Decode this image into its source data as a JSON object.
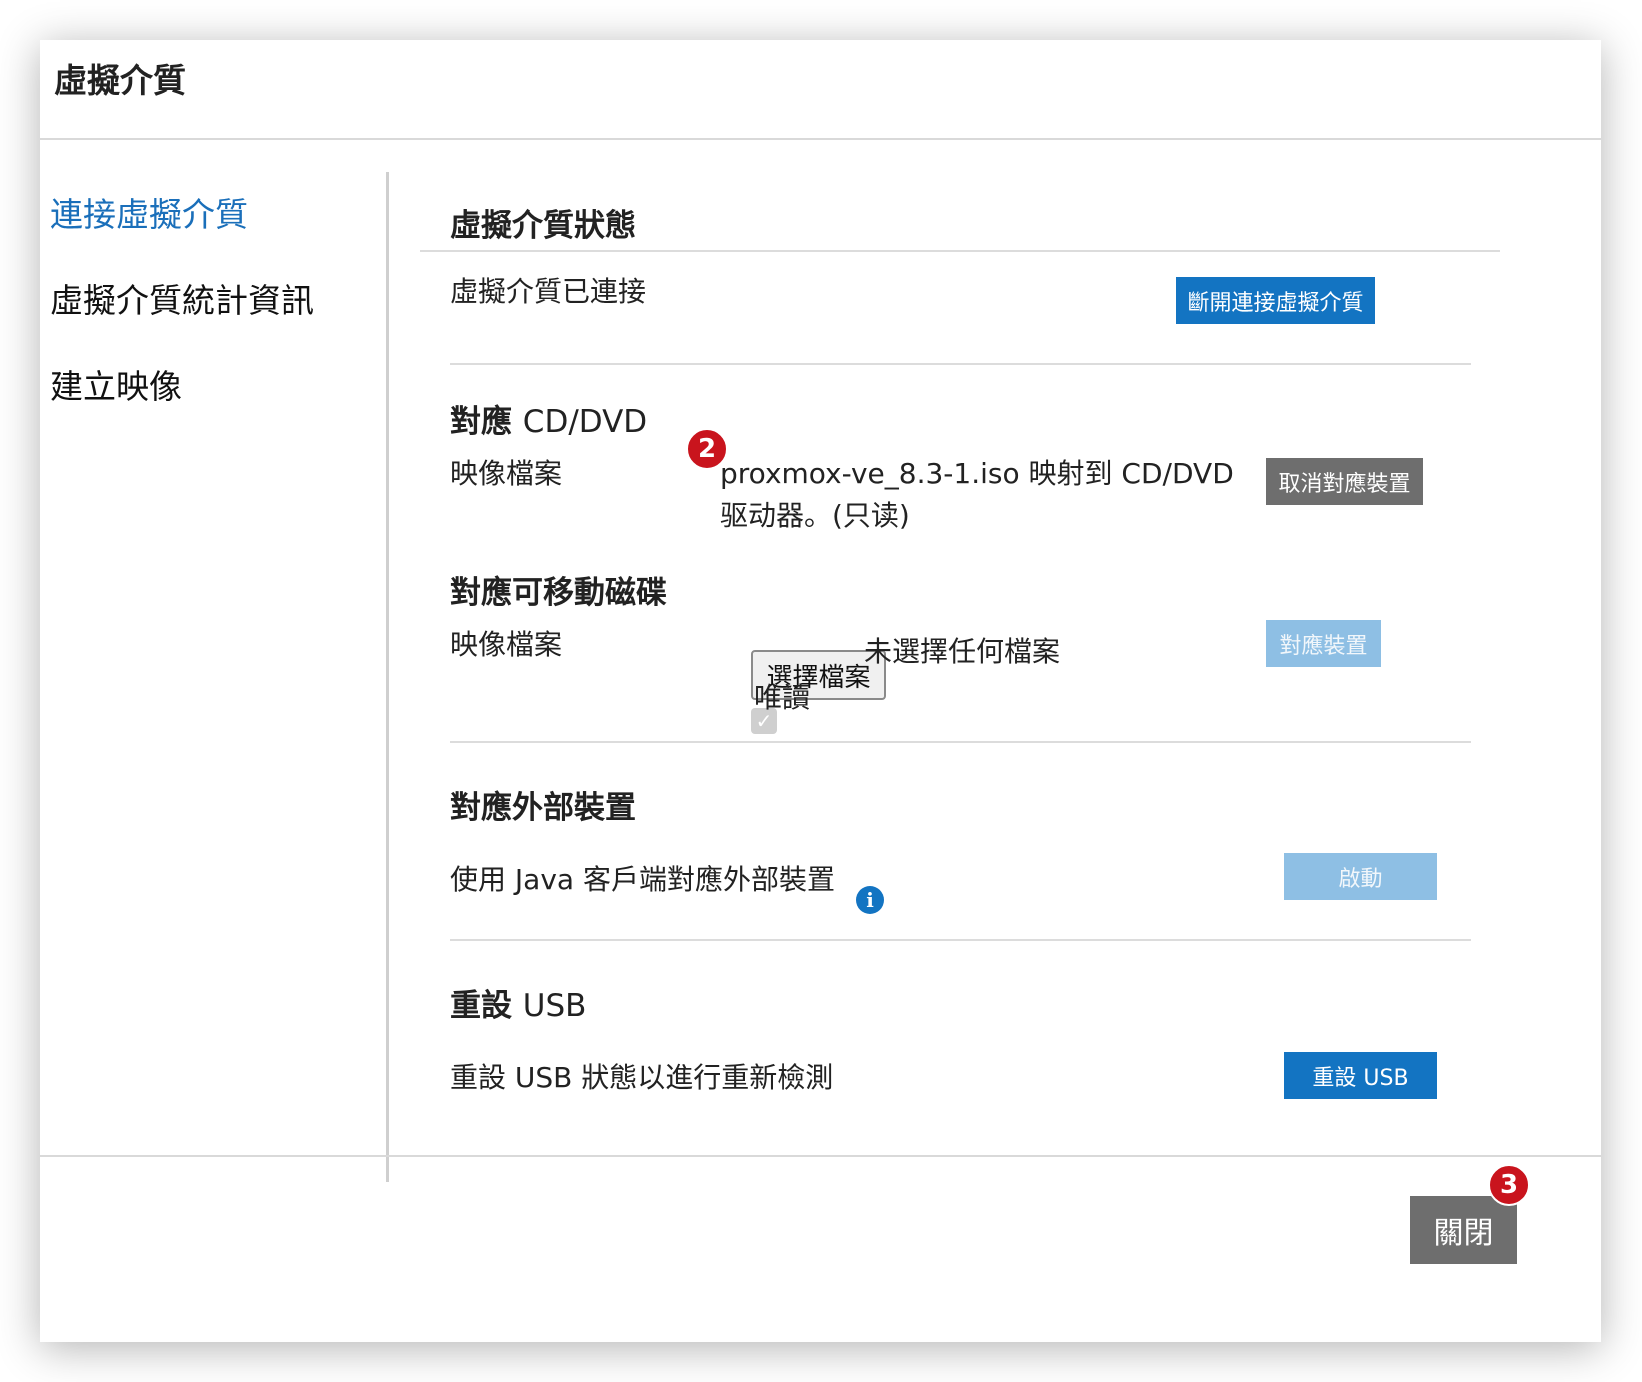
{
  "dialog": {
    "title": "虛擬介質"
  },
  "sidebar": {
    "items": [
      {
        "label": "連接虛擬介質",
        "active": true
      },
      {
        "label": "虛擬介質統計資訊",
        "active": false
      },
      {
        "label": "建立映像",
        "active": false
      }
    ]
  },
  "status": {
    "title": "虛擬介質狀態",
    "text": "虛擬介質已連接",
    "disconnect_label": "斷開連接虛擬介質"
  },
  "cd_dvd": {
    "title_bold": "對應",
    "title_rest": "CD/DVD",
    "label": "映像檔案",
    "mapped_line1": "proxmox-ve_8.3-1.iso 映射到 CD/DVD",
    "mapped_line2": "驱动器。(只读)",
    "unmap_label": "取消對應裝置"
  },
  "removable": {
    "title": "對應可移動磁碟",
    "label": "映像檔案",
    "choose_file_label": "選擇檔案",
    "no_file_text": "未選擇任何檔案",
    "readonly_label": "唯讀",
    "readonly_checked": true,
    "map_label": "對應裝置"
  },
  "external": {
    "title": "對應外部裝置",
    "text": "使用 Java 客戶端對應外部裝置",
    "start_label": "啟動"
  },
  "usb": {
    "title_bold": "重設",
    "title_rest": "USB",
    "text": "重設 USB 狀態以進行重新檢測",
    "reset_label": "重設 USB"
  },
  "footer": {
    "close_label": "關閉"
  },
  "badges": {
    "badge2": "2",
    "badge3": "3"
  },
  "colors": {
    "accent": "#1374c2",
    "active_link": "#1a6fba",
    "gray_button": "#6e6e6e",
    "disabled_button": "#8ebfe4",
    "badge": "#c9141d"
  }
}
